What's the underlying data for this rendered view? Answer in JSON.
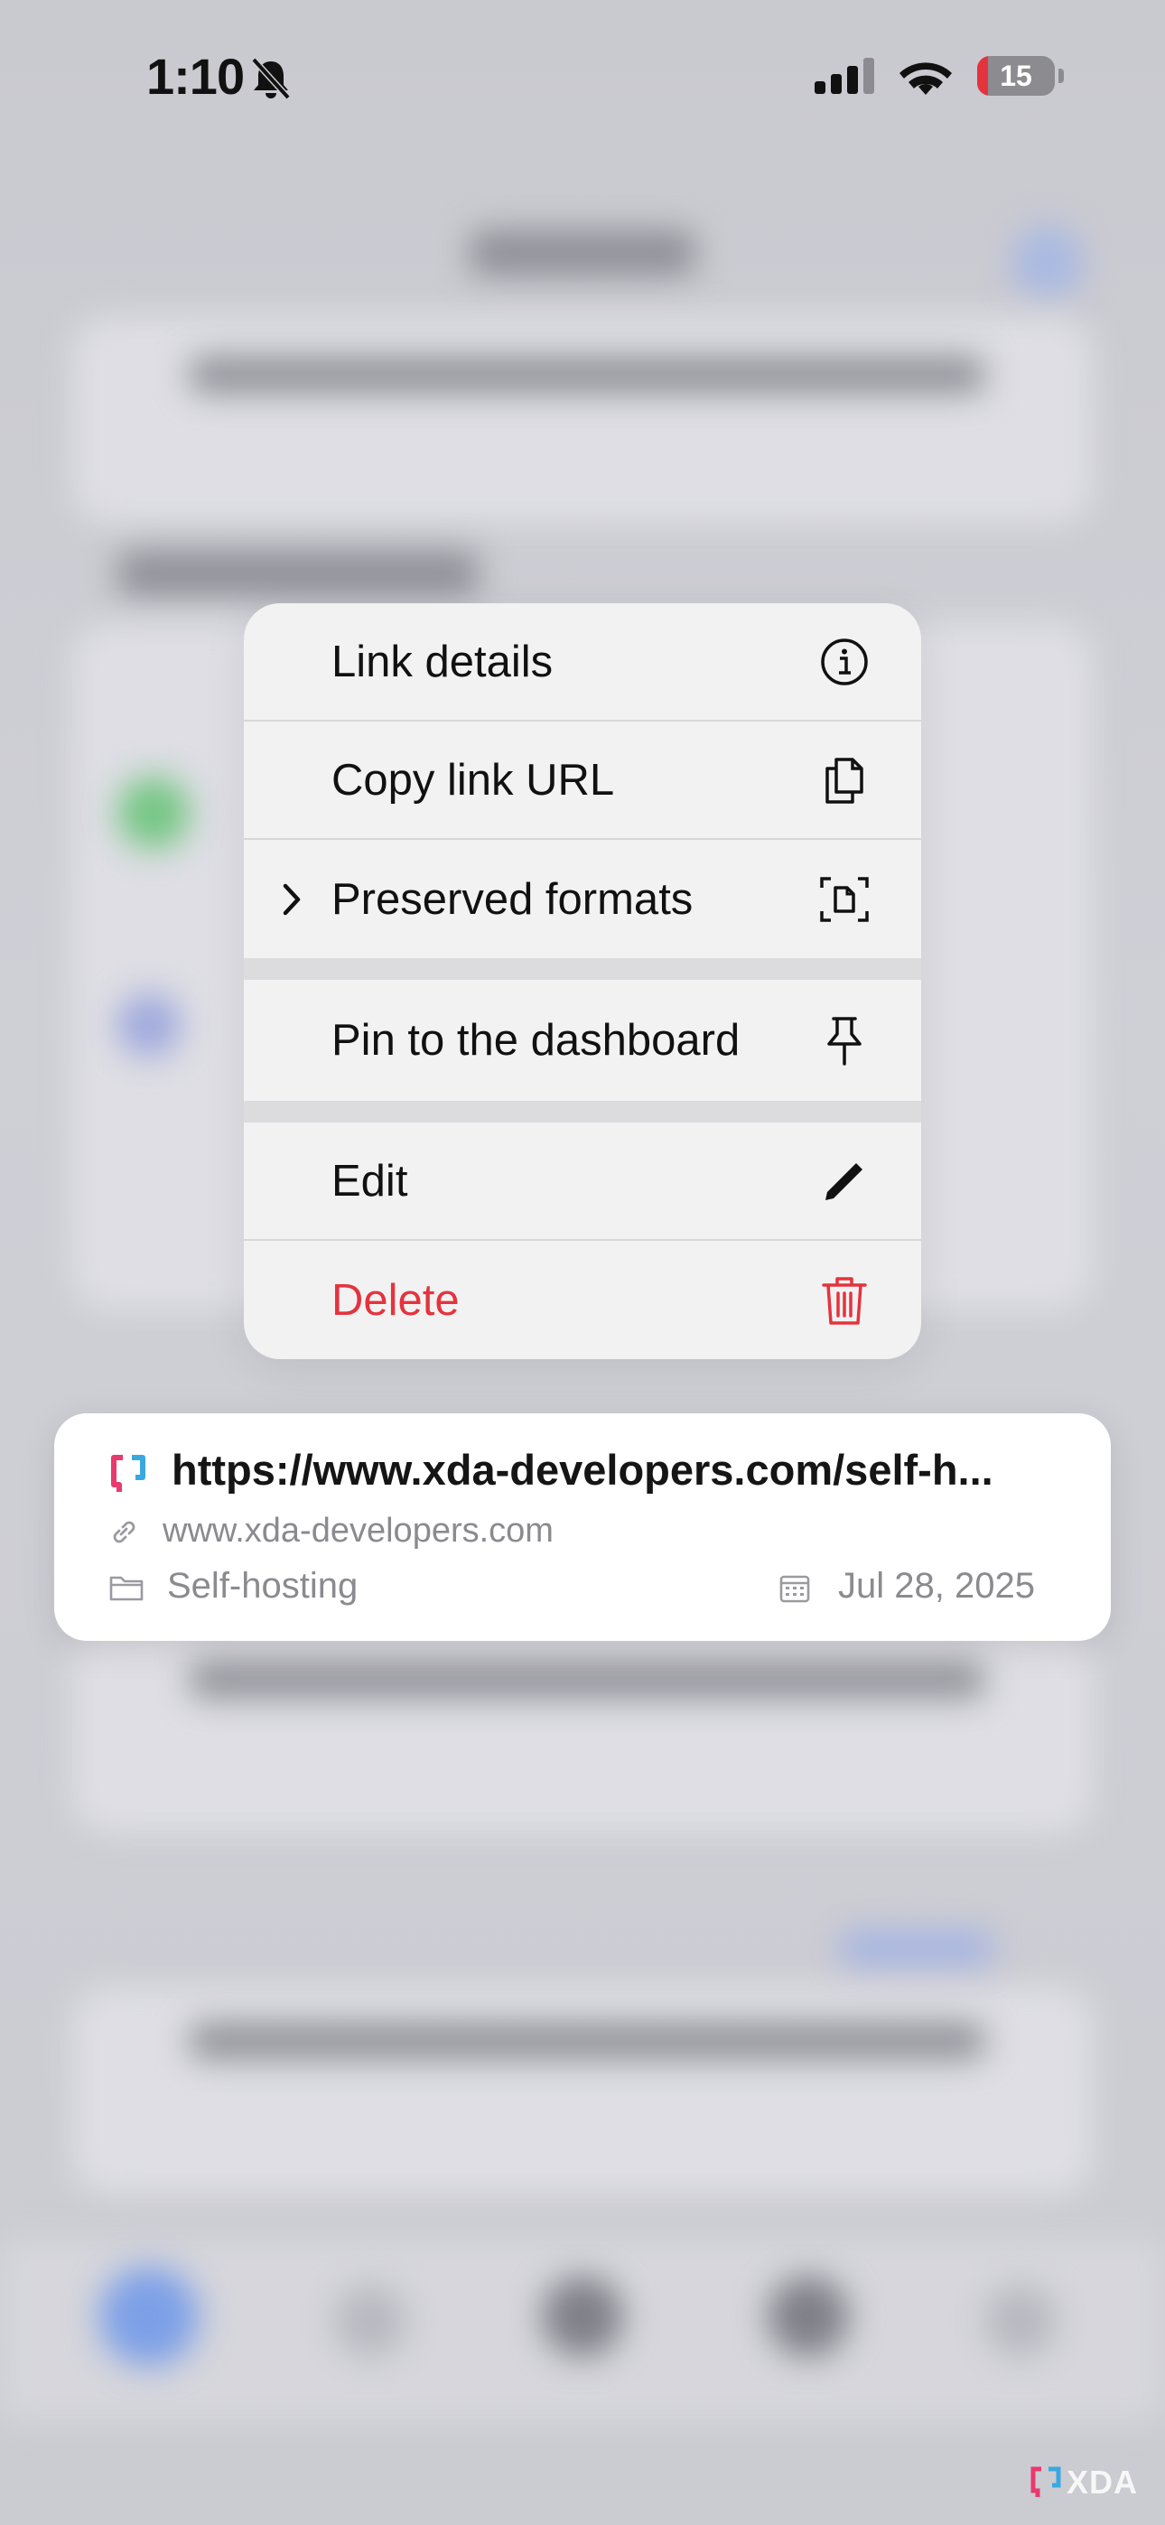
{
  "status_bar": {
    "time": "1:10",
    "battery_level": "15",
    "icons": [
      "bell-slash-icon",
      "cellular-signal-icon",
      "wifi-icon",
      "battery-icon"
    ]
  },
  "context_menu": {
    "items": [
      {
        "label": "Link details",
        "icon": "info-circle-icon"
      },
      {
        "label": "Copy link URL",
        "icon": "copy-document-icon"
      },
      {
        "label": "Preserved formats",
        "icon": "document-viewfinder-icon",
        "has_submenu": true
      },
      {
        "label": "Pin to the dashboard",
        "icon": "pin-icon"
      },
      {
        "label": "Edit",
        "icon": "pencil-icon"
      },
      {
        "label": "Delete",
        "icon": "trash-icon",
        "destructive": true
      }
    ],
    "destructive_color": "#e5333d"
  },
  "preview_card": {
    "title": "https://www.xda-developers.com/self-h...",
    "domain": "www.xda-developers.com",
    "collection": "Self-hosting",
    "date": "Jul 28, 2025"
  },
  "watermark": {
    "text": "XDA"
  }
}
